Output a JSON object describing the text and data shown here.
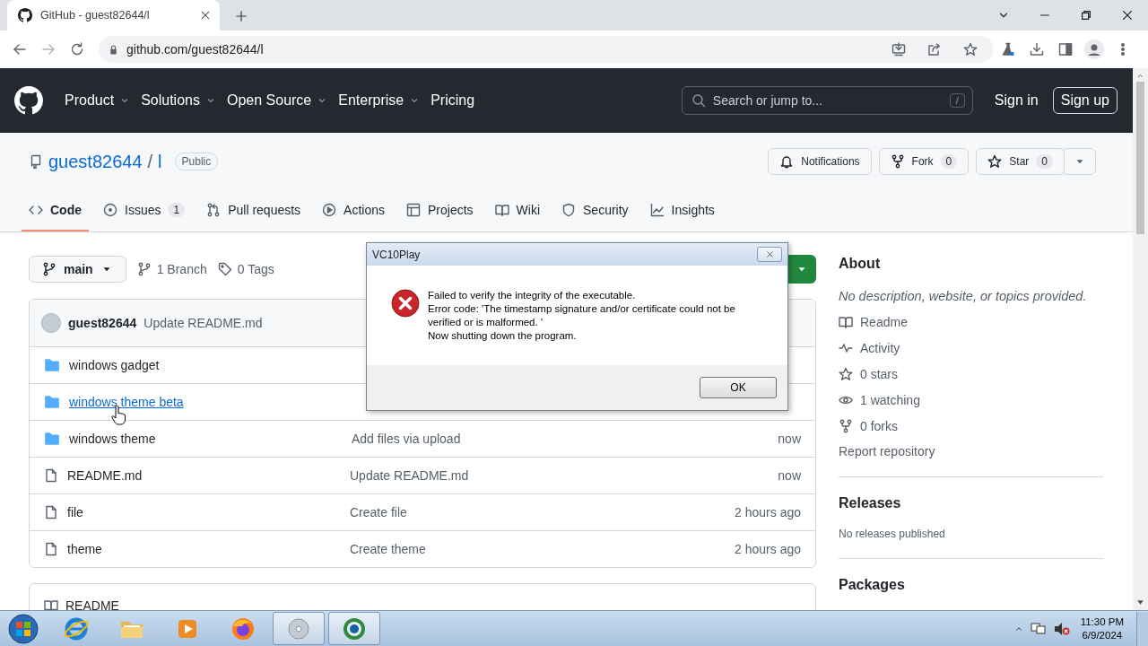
{
  "browser": {
    "tab_title": "GitHub - guest82644/l",
    "url": "github.com/guest82644/l"
  },
  "nav": {
    "items": [
      {
        "label": "Product",
        "dropdown": true
      },
      {
        "label": "Solutions",
        "dropdown": true
      },
      {
        "label": "Open Source",
        "dropdown": true
      },
      {
        "label": "Enterprise",
        "dropdown": true
      },
      {
        "label": "Pricing",
        "dropdown": false
      }
    ],
    "search_placeholder": "Search or jump to...",
    "search_key": "/",
    "sign_in": "Sign in",
    "sign_up": "Sign up"
  },
  "repo": {
    "owner": "guest82644",
    "separator": "/",
    "name": "l",
    "visibility": "Public",
    "actions": [
      {
        "kind": "bell",
        "label": "Notifications"
      },
      {
        "kind": "fork",
        "label": "Fork",
        "count": "0"
      },
      {
        "kind": "star",
        "label": "Star",
        "count": "0"
      }
    ]
  },
  "tabs": [
    {
      "kind": "code",
      "label": "Code",
      "selected": true
    },
    {
      "kind": "issue",
      "label": "Issues",
      "count": "1",
      "selected": false
    },
    {
      "kind": "pr",
      "label": "Pull requests",
      "selected": false
    },
    {
      "kind": "play",
      "label": "Actions",
      "selected": false
    },
    {
      "kind": "table",
      "label": "Projects",
      "selected": false
    },
    {
      "kind": "book",
      "label": "Wiki",
      "selected": false
    },
    {
      "kind": "shield",
      "label": "Security",
      "selected": false
    },
    {
      "kind": "graph",
      "label": "Insights",
      "selected": false
    }
  ],
  "branch": {
    "name": "main",
    "branches": "1 Branch",
    "tags": "0 Tags"
  },
  "commit": {
    "author": "guest82644",
    "message": "Update README.md"
  },
  "files": [
    {
      "kind": "folder",
      "name": "windows gadget",
      "hovered": false
    },
    {
      "kind": "folder",
      "name": "windows theme beta",
      "hovered": true
    },
    {
      "kind": "folder",
      "name": "windows theme",
      "message": "Add files via upload",
      "time": "now",
      "hovered": false
    },
    {
      "kind": "file",
      "name": "README.md",
      "message": "Update README.md",
      "time": "now",
      "hovered": false
    },
    {
      "kind": "file",
      "name": "file",
      "message": "Create file",
      "time": "2 hours ago",
      "hovered": false
    },
    {
      "kind": "file",
      "name": "theme",
      "message": "Create theme",
      "time": "2 hours ago",
      "hovered": false
    }
  ],
  "readme": {
    "title": "README"
  },
  "about": {
    "title": "About",
    "description": "No description, website, or topics provided.",
    "items": [
      {
        "kind": "book",
        "label": "Readme"
      },
      {
        "kind": "pulse",
        "label": "Activity"
      },
      {
        "kind": "star",
        "label": "0 stars"
      },
      {
        "kind": "eye",
        "label": "1 watching"
      },
      {
        "kind": "fork",
        "label": "0 forks"
      }
    ],
    "report": "Report repository"
  },
  "releases": {
    "title": "Releases",
    "note": "No releases published"
  },
  "packages": {
    "title": "Packages"
  },
  "dialog": {
    "title": "VC10Play",
    "lines": [
      "Failed to verify the integrity of the executable.",
      "Error code: 'The timestamp signature and/or certificate could not be verified or is malformed. '",
      "Now shutting down the program."
    ],
    "button": "OK"
  },
  "taskbar": {
    "apps": [
      {
        "kind": "ie",
        "active": false
      },
      {
        "kind": "explorer",
        "active": false
      },
      {
        "kind": "media",
        "active": false
      },
      {
        "kind": "firefox",
        "active": false
      },
      {
        "kind": "disc",
        "active": true
      },
      {
        "kind": "player",
        "active": true
      }
    ],
    "time": "11:30 PM",
    "date": "6/9/2024"
  }
}
